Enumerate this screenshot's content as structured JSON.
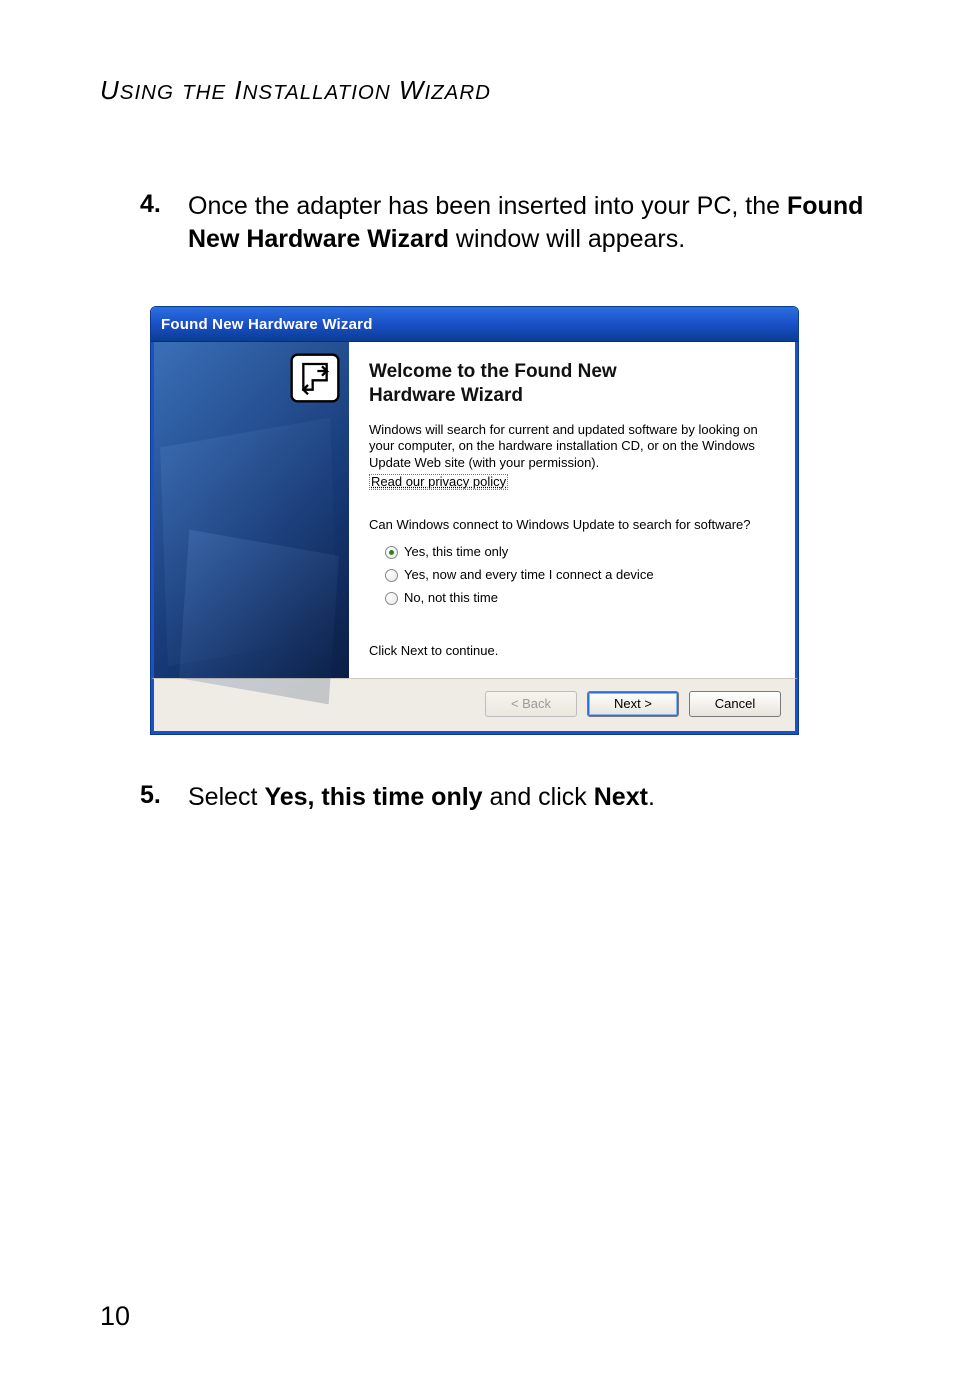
{
  "heading": {
    "U": "U",
    "sing": "SING",
    "the": "THE",
    "I": "I",
    "nstallation": "NSTALLATION",
    "W": "W",
    "izard": "IZARD"
  },
  "step4": {
    "num": "4.",
    "text_before": "Once the adapter has been inserted into your PC, the ",
    "bold1": "Found New Hardware Wizard",
    "text_after": " window will appears."
  },
  "dialog": {
    "title": "Found New Hardware Wizard",
    "welcome_line1": "Welcome to the Found New",
    "welcome_line2": "Hardware Wizard",
    "para": "Windows will search for current and updated software by looking on your computer, on the hardware installation CD, or on the Windows Update Web site (with your permission).",
    "privacy": "Read our privacy policy",
    "question": "Can Windows connect to Windows Update to search for software?",
    "radios": {
      "o1": "Yes, this time only",
      "o2": "Yes, now and every time I connect a device",
      "o3": "No, not this time"
    },
    "continue_hint": "Click Next to continue.",
    "buttons": {
      "back": "< Back",
      "next": "Next >",
      "cancel": "Cancel"
    }
  },
  "step5": {
    "num": "5.",
    "pre": "Select ",
    "bold1": "Yes, this time only",
    "mid": " and click ",
    "bold2": "Next",
    "post": "."
  },
  "page_number": "10"
}
